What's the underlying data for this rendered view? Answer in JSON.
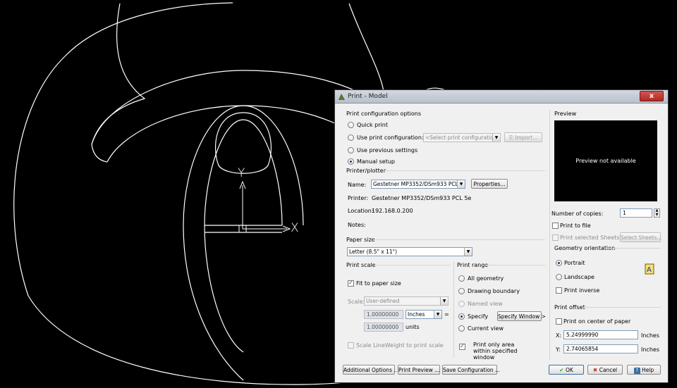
{
  "drawing": {
    "ucs_y_label": "Y",
    "ucs_x_label": "X"
  },
  "dialog": {
    "title": "Print - Model",
    "close_glyph": "x",
    "config": {
      "title": "Print configuration options",
      "quick_print": "Quick print",
      "use_config": "Use print configuration:",
      "config_placeholder": "<Select print configuration>",
      "import_label": "Import...",
      "use_previous": "Use previous settings",
      "manual_setup": "Manual setup",
      "selected": "manual_setup"
    },
    "printer": {
      "title": "Printer/plotter",
      "name_label": "Name:",
      "name_value": "Gestetner MP3352/DSm933 PCL 5e",
      "properties_label": "Properties...",
      "printer_label": "Printer:",
      "printer_value": "Gestetner MP3352/DSm933 PCL 5e",
      "location_label": "Location:",
      "location_value": "192.168.0.200",
      "notes_label": "Notes:"
    },
    "paper": {
      "title": "Paper size",
      "value": "Letter (8.5\" x 11\")"
    },
    "scale": {
      "title": "Print scale",
      "fit_label": "Fit to paper size",
      "fit_checked": true,
      "scale_label": "Scale:",
      "scale_value": "User-defined",
      "value1": "1.00000000",
      "unit": "Inches",
      "equals": "=",
      "value2": "1.00000000",
      "units_label": "units",
      "lineweight_label": "Scale LineWeight to print scale"
    },
    "range": {
      "title": "Print range",
      "all_geometry": "All geometry",
      "drawing_boundary": "Drawing boundary",
      "named_view": "Named view",
      "specify": "Specify",
      "specify_window_btn": "Specify Window >",
      "current_view": "Current view",
      "print_only_area": "Print only area within specified window",
      "print_only_area_checked": true,
      "selected": "specify"
    },
    "preview": {
      "title": "Preview",
      "message": "Preview not available"
    },
    "copies": {
      "label": "Number of copies:",
      "value": "1",
      "print_to_file": "Print to file",
      "print_selected_sheets": "Print selected Sheets",
      "select_sheets_btn": "Select Sheets..."
    },
    "orientation": {
      "title": "Geometry orientation",
      "portrait": "Portrait",
      "landscape": "Landscape",
      "print_inverse": "Print inverse",
      "selected": "portrait"
    },
    "offset": {
      "title": "Print offset",
      "center_label": "Print on center of paper",
      "x_label": "X:",
      "x_value": "5.24999990",
      "x_unit": "Inches",
      "y_label": "Y:",
      "y_value": "2.74065854",
      "y_unit": "Inches"
    },
    "buttons": {
      "additional_options": "Additional Options ...",
      "print_preview": "Print Preview ...",
      "save_configuration": "Save Configuration ...",
      "ok": "OK",
      "cancel": "Cancel",
      "help": "Help"
    }
  },
  "colors": {
    "background": "#000000",
    "drawing_lines": "#ffffff",
    "dialog_bg": "#f0f0f0",
    "close_button": "#c8403a",
    "ok_icon": "#2e9a2e",
    "cancel_icon": "#c0302a"
  }
}
